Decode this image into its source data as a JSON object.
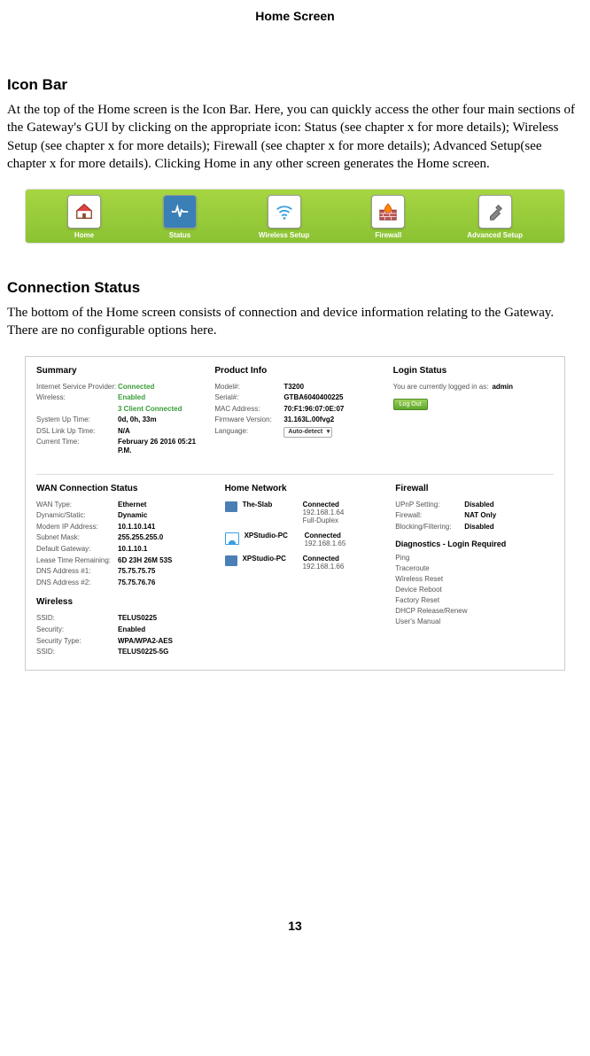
{
  "header": "Home Screen",
  "s1_title": "Icon Bar",
  "s1_body": "At the top of the Home screen is the Icon Bar. Here, you can quickly access the other four main sections of the Gateway's GUI by clicking on the appropriate icon: Status (see chapter x for more details); Wireless Setup (see chapter x for more details); Firewall (see chapter x for more details); Advanced Setup(see chapter x for more details). Clicking Home in any other screen generates the Home screen.",
  "iconbar": [
    {
      "name": "home",
      "label": "Home"
    },
    {
      "name": "status",
      "label": "Status"
    },
    {
      "name": "wireless",
      "label": "Wireless Setup"
    },
    {
      "name": "firewall",
      "label": "Firewall"
    },
    {
      "name": "advanced",
      "label": "Advanced Setup"
    }
  ],
  "s2_title": "Connection Status",
  "s2_body": "The bottom of the Home screen consists of connection and device information relating to the Gateway. There are no configurable options here.",
  "status": {
    "summary": {
      "title": "Summary",
      "rows": [
        {
          "k": "Internet Service Provider:",
          "v": "Connected",
          "green": true
        },
        {
          "k": "Wireless:",
          "v": "Enabled",
          "green": true
        },
        {
          "k": "",
          "v": "3 Client Connected",
          "green": true
        },
        {
          "k": "System Up Time:",
          "v": "0d, 0h, 33m"
        },
        {
          "k": "DSL Link Up Time:",
          "v": "N/A"
        },
        {
          "k": "Current Time:",
          "v": "February 26 2016 05:21 P.M."
        }
      ]
    },
    "product": {
      "title": "Product Info",
      "rows": [
        {
          "k": "Model#:",
          "v": "T3200"
        },
        {
          "k": "Serial#:",
          "v": "GTBA6040400225"
        },
        {
          "k": "MAC Address:",
          "v": "70:F1:96:07:0E:07"
        },
        {
          "k": "Firmware Version:",
          "v": "31.163L.00fvg2"
        },
        {
          "k": "Language:",
          "v": "Auto-detect",
          "select": true
        }
      ]
    },
    "login": {
      "title": "Login Status",
      "text": "You are currently logged in as:",
      "user": "admin",
      "button": "Log Out"
    },
    "wan": {
      "title": "WAN Connection Status",
      "rows": [
        {
          "k": "WAN Type:",
          "v": "Ethernet"
        },
        {
          "k": "Dynamic/Static:",
          "v": "Dynamic"
        },
        {
          "k": "Modem IP Address:",
          "v": "10.1.10.141"
        },
        {
          "k": "Subnet Mask:",
          "v": "255.255.255.0"
        },
        {
          "k": "Default Gateway:",
          "v": "10.1.10.1"
        },
        {
          "k": "Lease Time Remaining:",
          "v": "6D 23H 26M 53S"
        },
        {
          "k": "DNS Address #1:",
          "v": "75.75.75.75"
        },
        {
          "k": "DNS Address #2:",
          "v": "75.75.76.76"
        }
      ]
    },
    "wireless": {
      "title": "Wireless",
      "rows": [
        {
          "k": "SSID:",
          "v": "TELUS0225"
        },
        {
          "k": "Security:",
          "v": "Enabled"
        },
        {
          "k": "Security Type:",
          "v": "WPA/WPA2-AES"
        },
        {
          "k": "SSID:",
          "v": "TELUS0225-5G"
        }
      ]
    },
    "home_network": {
      "title": "Home Network",
      "items": [
        {
          "icon": "pc",
          "name": "The-Slab",
          "status": "Connected",
          "ip": "192.168.1.64",
          "extra": "Full-Duplex"
        },
        {
          "icon": "wifi",
          "name": "XPStudio-PC",
          "status": "Connected",
          "ip": "192.168.1.65"
        },
        {
          "icon": "pc",
          "name": "XPStudio-PC",
          "status": "Connected",
          "ip": "192.168.1.66"
        }
      ]
    },
    "firewall": {
      "title": "Firewall",
      "rows": [
        {
          "k": "UPnP Setting:",
          "v": "Disabled"
        },
        {
          "k": "Firewall:",
          "v": "NAT Only"
        },
        {
          "k": "Blocking/Filtering:",
          "v": "Disabled"
        }
      ]
    },
    "diag": {
      "title": "Diagnostics - Login Required",
      "items": [
        "Ping",
        "Traceroute",
        "Wireless Reset",
        "Device Reboot",
        "Factory Reset",
        "DHCP Release/Renew",
        "User's Manual"
      ]
    }
  },
  "page_num": "13"
}
